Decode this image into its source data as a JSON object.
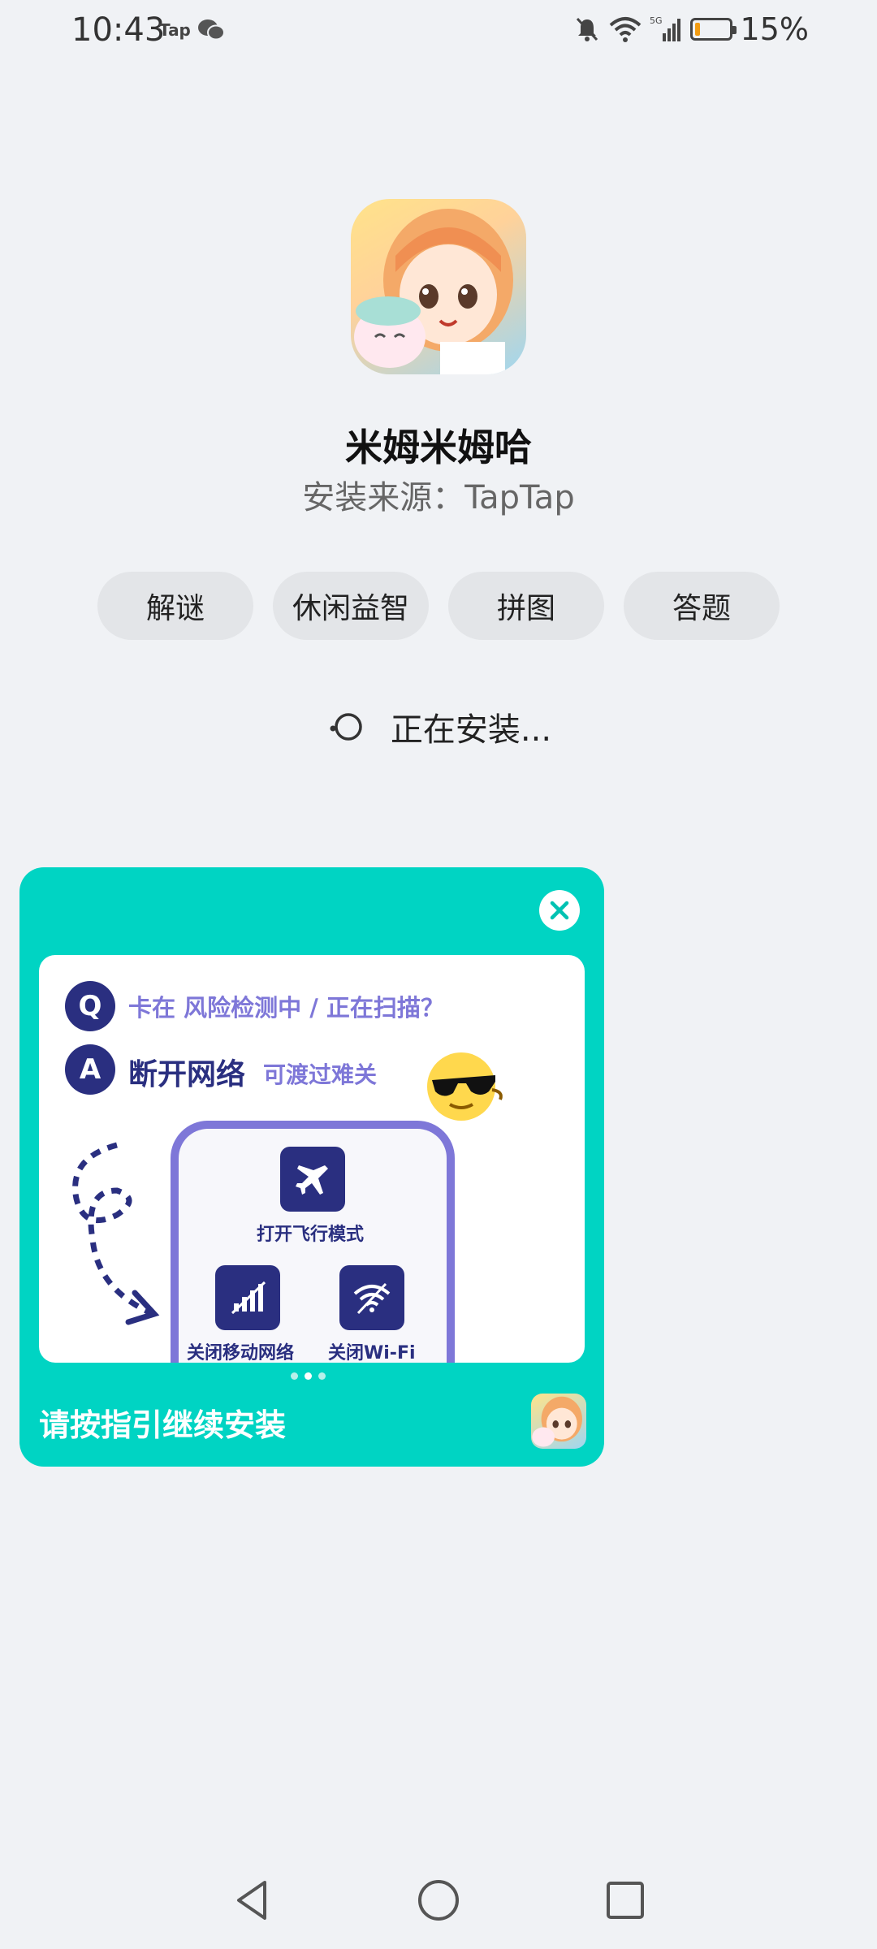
{
  "status_bar": {
    "time": "10:43",
    "app_badge": "Tap",
    "battery_percent": "15%",
    "battery_level": 0.15,
    "network_label": "5G"
  },
  "app": {
    "name": "米姆米姆哈",
    "install_source": "安装来源：TapTap",
    "tags": [
      "解谜",
      "休闲益智",
      "拼图",
      "答题"
    ]
  },
  "progress": {
    "status_text": "正在安装..."
  },
  "banner": {
    "question_badge": "Q",
    "question": "卡在 风险检测中 / 正在扫描？",
    "answer_badge": "A",
    "answer_main": "断开网络",
    "answer_sub": "可渡过难关",
    "steps": [
      "打开飞行模式",
      "关闭移动网络",
      "关闭Wi-Fi"
    ],
    "pagination": {
      "count": 3,
      "active": 1
    },
    "cta": "请按指引继续安装",
    "accent_color": "#00d4c3",
    "dark_color": "#2a2f80",
    "purple_color": "#7e77d8"
  },
  "icons": {
    "close": "close-icon",
    "airplane": "airplane-icon",
    "mobile_data_off": "mobile-data-off-icon",
    "wifi_off": "wifi-off-icon",
    "back": "back-icon",
    "home": "home-icon",
    "recents": "recents-icon"
  }
}
